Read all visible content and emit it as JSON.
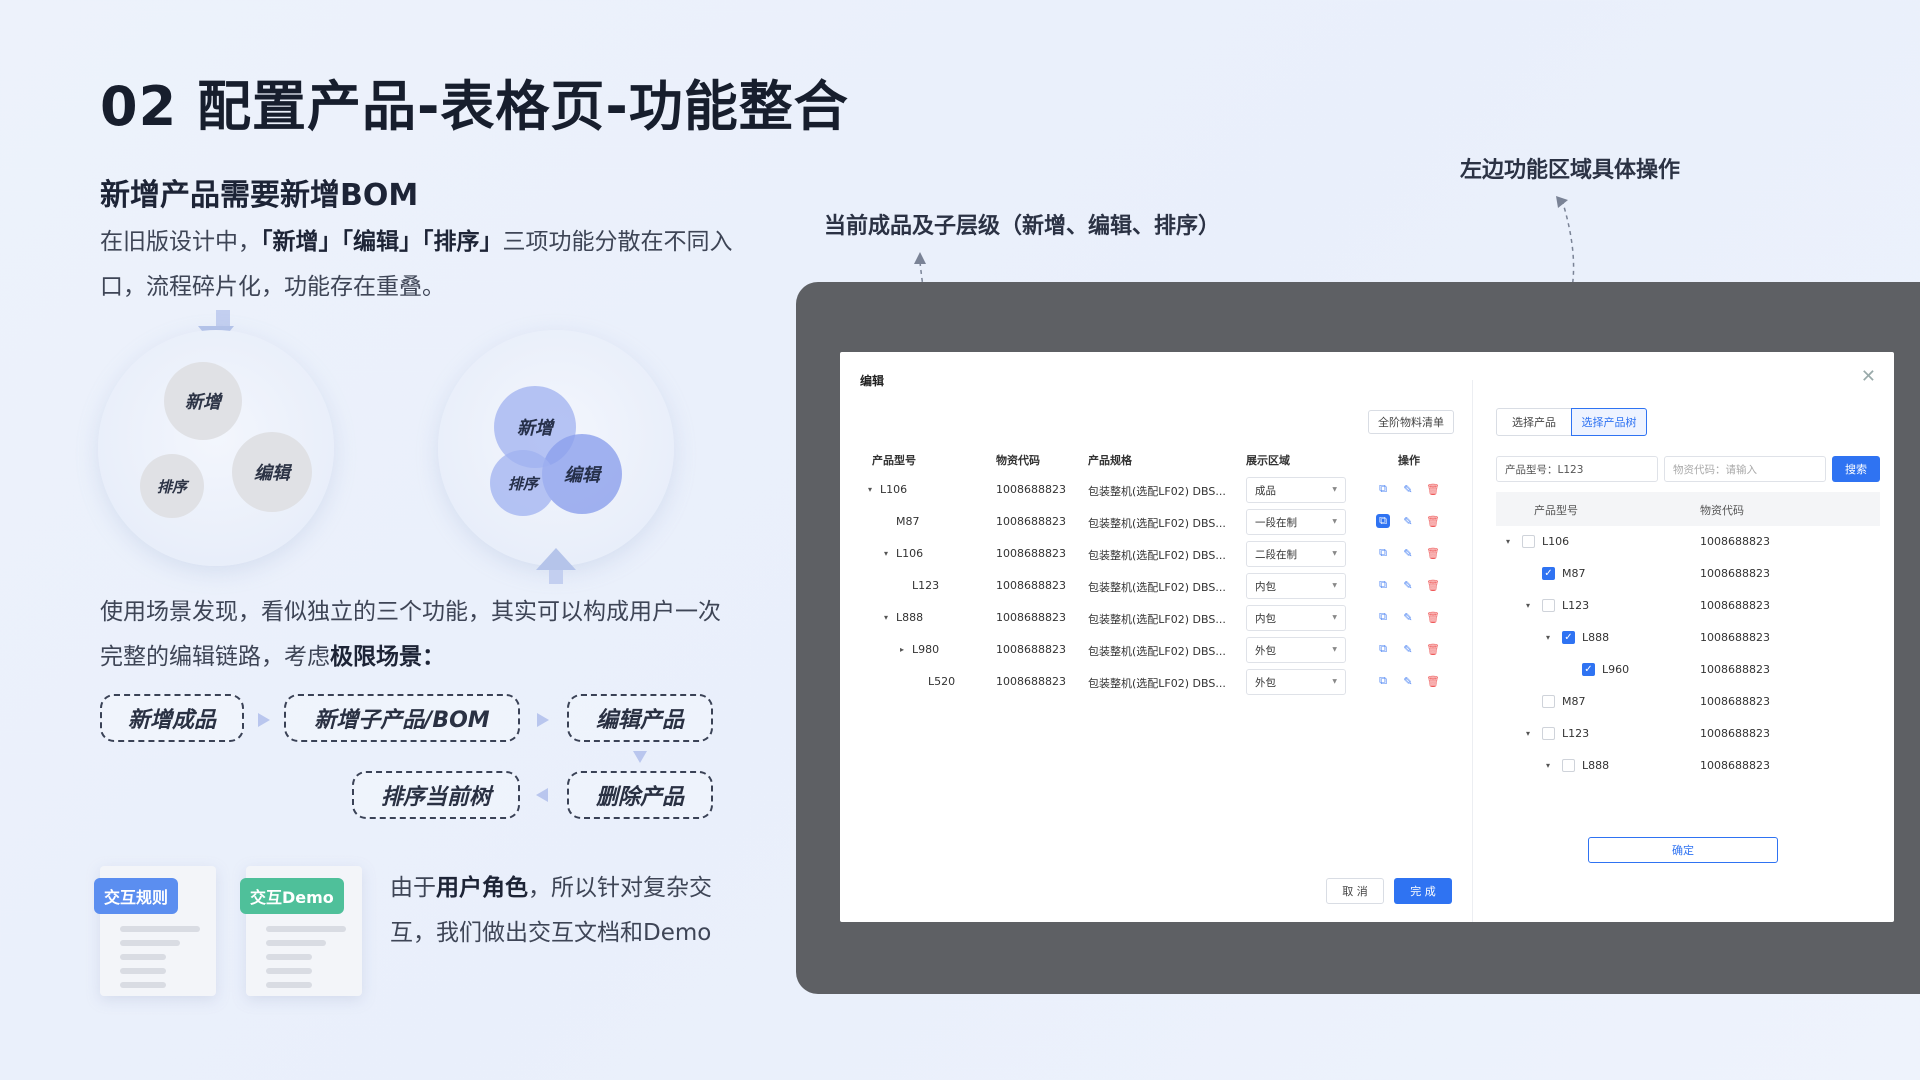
{
  "slide": {
    "title": "02 配置产品-表格页-功能整合",
    "subtitle": "新增产品需要新增BOM",
    "intro_pre": "在旧版设计中，",
    "intro_bold": "「新增」「编辑」「排序」",
    "intro_post": "三项功能分散在不同入口，流程碎片化，功能存在重叠。",
    "finding_pre": "使用场景发现，看似独立的三个功能，其实可以构成用户一次完整的编辑链路，考虑",
    "finding_bold": "极限场景：",
    "conclusion_pre": "由于",
    "conclusion_bold": "用户角色",
    "conclusion_post": "，所以针对复杂交互，我们做出交互文档和Demo",
    "venn_old": {
      "a": "新增",
      "b": "编辑",
      "c": "排序"
    },
    "venn_new": {
      "a": "新增",
      "b": "编辑",
      "c": "排序"
    },
    "flow": [
      "新增成品",
      "新增子产品/BOM",
      "编辑产品",
      "删除产品",
      "排序当前树"
    ],
    "docs": [
      {
        "tag": "交互规则",
        "color": "#5b8ef0"
      },
      {
        "tag": "交互Demo",
        "color": "#4fc09a"
      }
    ],
    "annotation_left": "当前成品及子层级（新增、编辑、排序）",
    "annotation_right": "左边功能区域具体操作"
  },
  "dialog": {
    "title": "编辑",
    "close_icon": "close-icon",
    "bom_button": "全阶物料清单",
    "columns": [
      "产品型号",
      "物资代码",
      "产品规格",
      "展示区域",
      "操作"
    ],
    "rows": [
      {
        "name": "L106",
        "indent": 0,
        "caret": "▾",
        "code": "1008688823",
        "spec": "包装整机(选配LF02) DBS...",
        "area": "成品",
        "active": false
      },
      {
        "name": "M87",
        "indent": 1,
        "caret": "",
        "code": "1008688823",
        "spec": "包装整机(选配LF02) DBS...",
        "area": "一段在制",
        "active": true
      },
      {
        "name": "L106",
        "indent": 1,
        "caret": "▾",
        "code": "1008688823",
        "spec": "包装整机(选配LF02) DBS...",
        "area": "二段在制",
        "active": false
      },
      {
        "name": "L123",
        "indent": 2,
        "caret": "",
        "code": "1008688823",
        "spec": "包装整机(选配LF02) DBS...",
        "area": "内包",
        "active": false
      },
      {
        "name": "L888",
        "indent": 1,
        "caret": "▾",
        "code": "1008688823",
        "spec": "包装整机(选配LF02) DBS...",
        "area": "内包",
        "active": false
      },
      {
        "name": "L980",
        "indent": 2,
        "caret": "▸",
        "code": "1008688823",
        "spec": "包装整机(选配LF02) DBS...",
        "area": "外包",
        "active": false
      },
      {
        "name": "L520",
        "indent": 3,
        "caret": "",
        "code": "1008688823",
        "spec": "包装整机(选配LF02) DBS...",
        "area": "外包",
        "active": false
      }
    ],
    "cancel": "取 消",
    "done": "完 成",
    "tabs": [
      "选择产品",
      "选择产品树"
    ],
    "search_model": "产品型号：L123",
    "search_code_placeholder": "物资代码：请输入",
    "search_button": "搜索",
    "tree_columns": [
      "产品型号",
      "物资代码"
    ],
    "tree": [
      {
        "name": "L106",
        "level": 0,
        "caret": "▾",
        "checked": false,
        "code": "1008688823"
      },
      {
        "name": "M87",
        "level": 1,
        "caret": "",
        "checked": true,
        "code": "1008688823"
      },
      {
        "name": "L123",
        "level": 1,
        "caret": "▾",
        "checked": false,
        "code": "1008688823"
      },
      {
        "name": "L888",
        "level": 2,
        "caret": "▾",
        "checked": true,
        "code": "1008688823"
      },
      {
        "name": "L960",
        "level": 3,
        "caret": "",
        "checked": true,
        "code": "1008688823"
      },
      {
        "name": "M87",
        "level": 1,
        "caret": "",
        "checked": false,
        "code": "1008688823"
      },
      {
        "name": "L123",
        "level": 1,
        "caret": "▾",
        "checked": false,
        "code": "1008688823"
      },
      {
        "name": "L888",
        "level": 2,
        "caret": "▾",
        "checked": false,
        "code": "1008688823"
      }
    ],
    "confirm": "确定"
  }
}
